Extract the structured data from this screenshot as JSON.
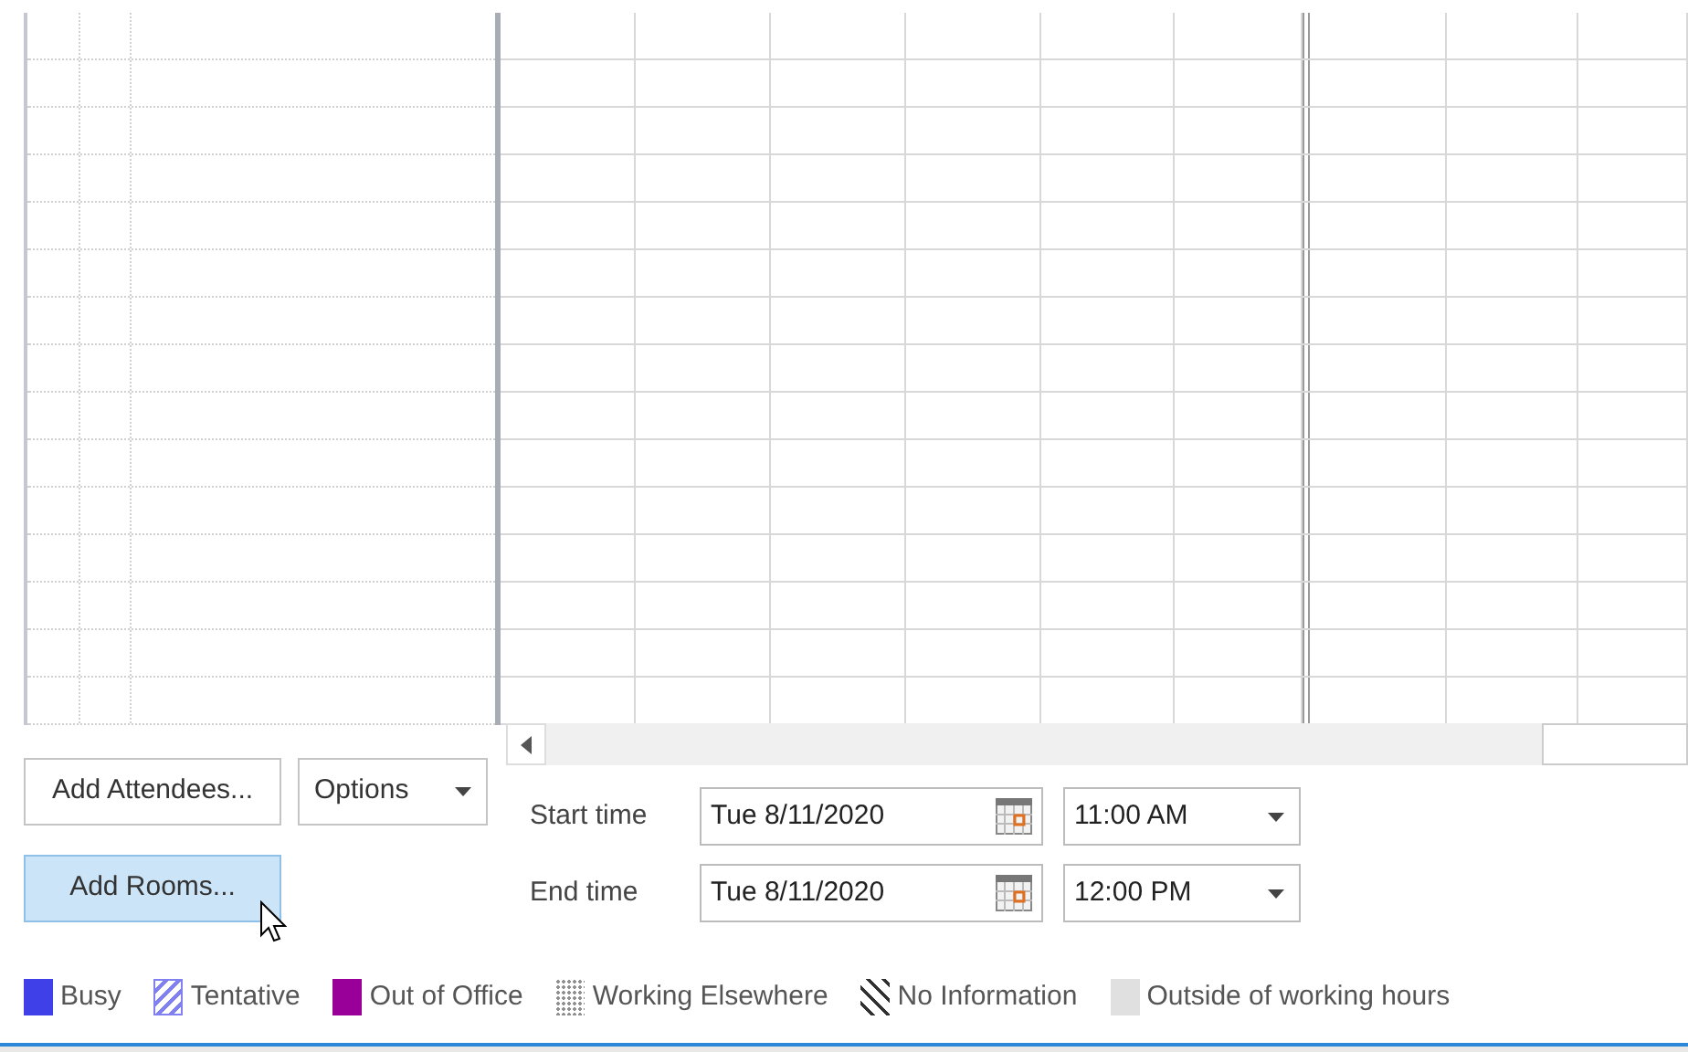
{
  "buttons": {
    "add_attendees": "Add Attendees...",
    "options": "Options",
    "add_rooms": "Add Rooms..."
  },
  "add_rooms_hovered": true,
  "start": {
    "label": "Start time",
    "date": "Tue 8/11/2020",
    "time": "11:00 AM"
  },
  "end": {
    "label": "End time",
    "date": "Tue 8/11/2020",
    "time": "12:00 PM"
  },
  "legend": [
    {
      "label": "Busy",
      "kind": "solid",
      "color": "#4040e8"
    },
    {
      "label": "Tentative",
      "kind": "striped",
      "color": "#8080f0"
    },
    {
      "label": "Out of Office",
      "kind": "solid",
      "color": "#990099"
    },
    {
      "label": "Working Elsewhere",
      "kind": "dotted",
      "color": "#909090"
    },
    {
      "label": "No Information",
      "kind": "hatched",
      "color": "#303030"
    },
    {
      "label": "Outside of working hours",
      "kind": "solid",
      "color": "#e0e0e0"
    }
  ]
}
